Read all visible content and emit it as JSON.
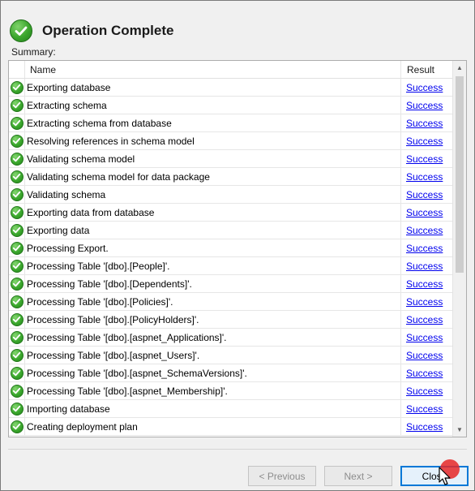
{
  "dialog": {
    "title": "Operation Complete",
    "summary_label": "Summary:"
  },
  "table": {
    "columns": [
      "Name",
      "Result"
    ],
    "rows": [
      {
        "name": "Exporting database",
        "result": "Success"
      },
      {
        "name": "Extracting schema",
        "result": "Success"
      },
      {
        "name": "Extracting schema from database",
        "result": "Success"
      },
      {
        "name": "Resolving references in schema model",
        "result": "Success"
      },
      {
        "name": "Validating schema model",
        "result": "Success"
      },
      {
        "name": "Validating schema model for data package",
        "result": "Success"
      },
      {
        "name": "Validating schema",
        "result": "Success"
      },
      {
        "name": "Exporting data from database",
        "result": "Success"
      },
      {
        "name": "Exporting data",
        "result": "Success"
      },
      {
        "name": "Processing Export.",
        "result": "Success"
      },
      {
        "name": "Processing Table '[dbo].[People]'.",
        "result": "Success"
      },
      {
        "name": "Processing Table '[dbo].[Dependents]'.",
        "result": "Success"
      },
      {
        "name": "Processing Table '[dbo].[Policies]'.",
        "result": "Success"
      },
      {
        "name": "Processing Table '[dbo].[PolicyHolders]'.",
        "result": "Success"
      },
      {
        "name": "Processing Table '[dbo].[aspnet_Applications]'.",
        "result": "Success"
      },
      {
        "name": "Processing Table '[dbo].[aspnet_Users]'.",
        "result": "Success"
      },
      {
        "name": "Processing Table '[dbo].[aspnet_SchemaVersions]'.",
        "result": "Success"
      },
      {
        "name": "Processing Table '[dbo].[aspnet_Membership]'.",
        "result": "Success"
      },
      {
        "name": "Importing database",
        "result": "Success"
      },
      {
        "name": "Creating deployment plan",
        "result": "Success"
      }
    ]
  },
  "buttons": {
    "previous": "< Previous",
    "next": "Next >",
    "close": "Close"
  },
  "colors": {
    "success_green": "#3ba82d",
    "link_blue": "#0000ee",
    "focus_blue": "#0078d7"
  },
  "icons": {
    "status": "check-circle-icon"
  }
}
